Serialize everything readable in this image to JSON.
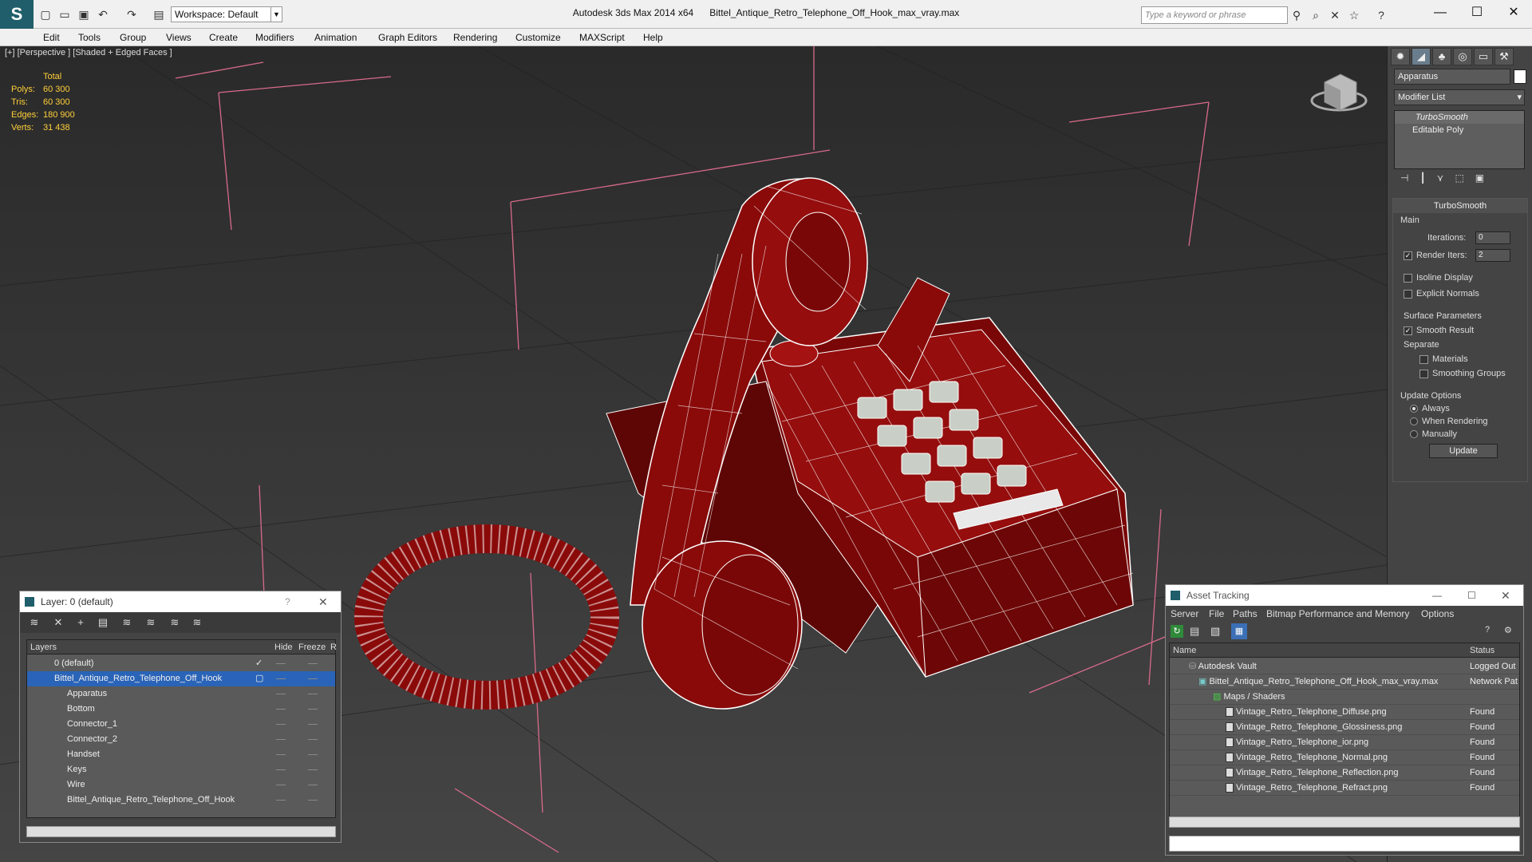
{
  "titlebar": {
    "app_title": "Autodesk 3ds Max  2014 x64",
    "file_name": "Bittel_Antique_Retro_Telephone_Off_Hook_max_vray.max",
    "workspace_label": "Workspace: Default",
    "search_placeholder": "Type a keyword or phrase"
  },
  "menu": [
    "Edit",
    "Tools",
    "Group",
    "Views",
    "Create",
    "Modifiers",
    "Animation",
    "Graph Editors",
    "Rendering",
    "Customize",
    "MAXScript",
    "Help"
  ],
  "viewport": {
    "label": "[+] [Perspective ] [Shaded + Edged Faces ]",
    "stats": {
      "header": "Total",
      "rows": [
        {
          "label": "Polys:",
          "value": "60 300"
        },
        {
          "label": "Tris:",
          "value": "60 300"
        },
        {
          "label": "Edges:",
          "value": "180 900"
        },
        {
          "label": "Verts:",
          "value": "31 438"
        }
      ]
    }
  },
  "command_panel": {
    "object_name": "Apparatus",
    "modifier_list": "Modifier List",
    "stack": [
      "TurboSmooth",
      "Editable Poly"
    ],
    "rollout_title": "TurboSmooth",
    "main_label": "Main",
    "iterations_label": "Iterations:",
    "iterations_value": "0",
    "render_iters_label": "Render Iters:",
    "render_iters_value": "2",
    "isoline_label": "Isoline Display",
    "explicit_normals_label": "Explicit Normals",
    "surface_params_label": "Surface Parameters",
    "smooth_result_label": "Smooth Result",
    "separate_label": "Separate",
    "materials_label": "Materials",
    "smoothing_groups_label": "Smoothing Groups",
    "update_options_label": "Update Options",
    "always_label": "Always",
    "when_rendering_label": "When Rendering",
    "manually_label": "Manually",
    "update_button": "Update"
  },
  "layer_window": {
    "title": "Layer: 0 (default)",
    "help": "?",
    "col_layers": "Layers",
    "col_hide": "Hide",
    "col_freeze": "Freeze",
    "col_r": "R",
    "rows": [
      {
        "name": "0 (default)"
      },
      {
        "name": "Bittel_Antique_Retro_Telephone_Off_Hook"
      },
      {
        "name": "Apparatus"
      },
      {
        "name": "Bottom"
      },
      {
        "name": "Connector_1"
      },
      {
        "name": "Connector_2"
      },
      {
        "name": "Handset"
      },
      {
        "name": "Keys"
      },
      {
        "name": "Wire"
      },
      {
        "name": "Bittel_Antique_Retro_Telephone_Off_Hook"
      }
    ]
  },
  "asset_window": {
    "title": "Asset Tracking",
    "menu": [
      "Server",
      "File",
      "Paths",
      "Bitmap Performance and Memory",
      "Options"
    ],
    "col_name": "Name",
    "col_status": "Status",
    "rows": [
      {
        "name": "Autodesk Vault",
        "status": "Logged Out"
      },
      {
        "name": "Bittel_Antique_Retro_Telephone_Off_Hook_max_vray.max",
        "status": "Network Pat"
      },
      {
        "name": "Maps / Shaders",
        "status": ""
      },
      {
        "name": "Vintage_Retro_Telephone_Diffuse.png",
        "status": "Found"
      },
      {
        "name": "Vintage_Retro_Telephone_Glossiness.png",
        "status": "Found"
      },
      {
        "name": "Vintage_Retro_Telephone_ior.png",
        "status": "Found"
      },
      {
        "name": "Vintage_Retro_Telephone_Normal.png",
        "status": "Found"
      },
      {
        "name": "Vintage_Retro_Telephone_Reflection.png",
        "status": "Found"
      },
      {
        "name": "Vintage_Retro_Telephone_Refract.png",
        "status": "Found"
      }
    ]
  },
  "colors": {
    "model": "#8a0a0a",
    "wire": "#ffffff",
    "bbox": "#d86a8a",
    "stats": "#ffcf3a",
    "selection": "#2a64b8"
  },
  "icons": [
    "max-logo-icon",
    "new-icon",
    "open-icon",
    "save-icon",
    "undo-icon",
    "redo-icon",
    "search-icon",
    "help-icon",
    "viewcube-icon"
  ]
}
